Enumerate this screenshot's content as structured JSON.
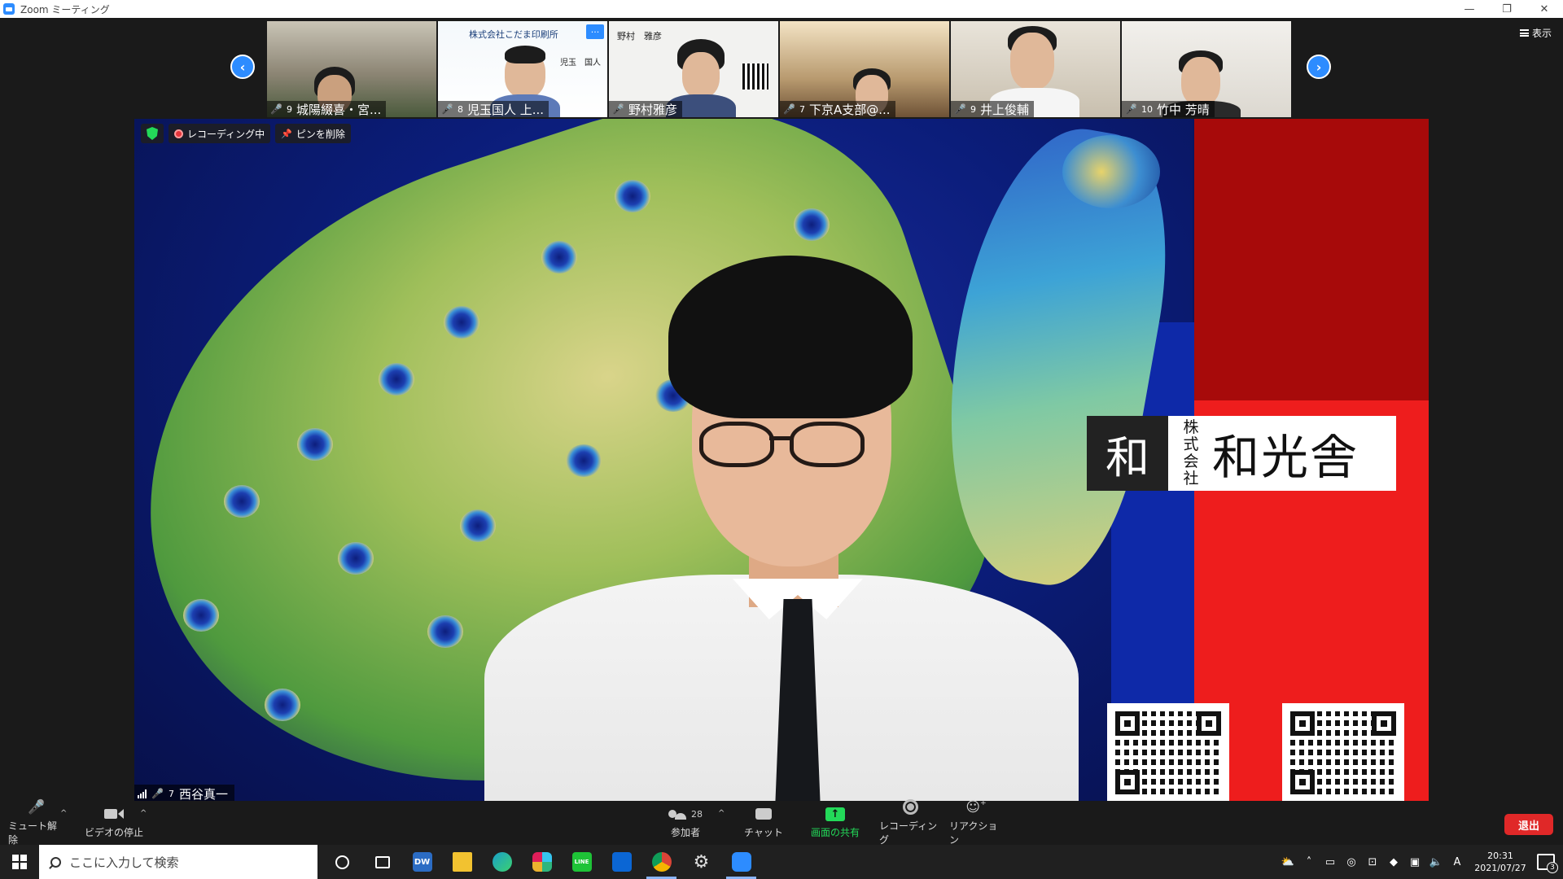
{
  "window": {
    "title": "Zoom ミーティング",
    "minimize": "—",
    "restore": "❐",
    "close": "✕"
  },
  "gallery": {
    "show_label": "表示",
    "prev_arrow": "‹",
    "next_arrow": "›",
    "tiles": [
      {
        "count": "9",
        "name": "城陽綴喜・宮..."
      },
      {
        "count": "8",
        "name": "児玉国人 上...",
        "card_company": "株式会社こだま印刷所",
        "card_person": "児玉　国人",
        "more": "···"
      },
      {
        "count": "",
        "name": "野村雅彦",
        "card_person": "野村　雅彦"
      },
      {
        "count": "7",
        "name": "下京A支部@..."
      },
      {
        "count": "9",
        "name": "井上俊輔"
      },
      {
        "count": "10",
        "name": "竹中 芳晴"
      }
    ]
  },
  "main_video": {
    "security_label": "",
    "recording_label": "レコーディング中",
    "unpin_label": "ピンを削除",
    "speaker_count": "7",
    "speaker_name": "西谷真一",
    "logo_mark": "和",
    "logo_kabushiki": "株式会社",
    "logo_company": "和光舎"
  },
  "toolbar": {
    "mute_label": "ミュート解除",
    "video_label": "ビデオの停止",
    "participants_label": "参加者",
    "participants_count": "28",
    "chat_label": "チャット",
    "share_label": "画面の共有",
    "record_label": "レコーディング",
    "reaction_label": "リアクション",
    "leave_label": "退出",
    "caret": "^"
  },
  "taskbar": {
    "search_placeholder": "ここに入力して検索",
    "time": "20:31",
    "date": "2021/07/27",
    "ime": "A",
    "notification_count": "3",
    "apps": [
      {
        "name": "dw",
        "label": "DW",
        "color": "#2b6cc4"
      },
      {
        "name": "explorer",
        "label": "",
        "color": "#f2c230"
      },
      {
        "name": "edge",
        "label": "",
        "color": "#1aa0c9"
      },
      {
        "name": "slack",
        "label": "",
        "color": "#4a154b"
      },
      {
        "name": "line",
        "label": "LINE",
        "color": "#1ec337"
      },
      {
        "name": "trello",
        "label": "",
        "color": "#0b66d4"
      },
      {
        "name": "chrome",
        "label": "",
        "color": "#db4437"
      },
      {
        "name": "settings",
        "label": "⚙",
        "color": "#202020"
      },
      {
        "name": "zoom",
        "label": "",
        "color": "#2d8cff"
      }
    ]
  },
  "colors": {
    "zoom_blue": "#2d8cff",
    "leave_red": "#e02828",
    "share_green": "#23d959",
    "mic_off_red": "#e02828"
  }
}
